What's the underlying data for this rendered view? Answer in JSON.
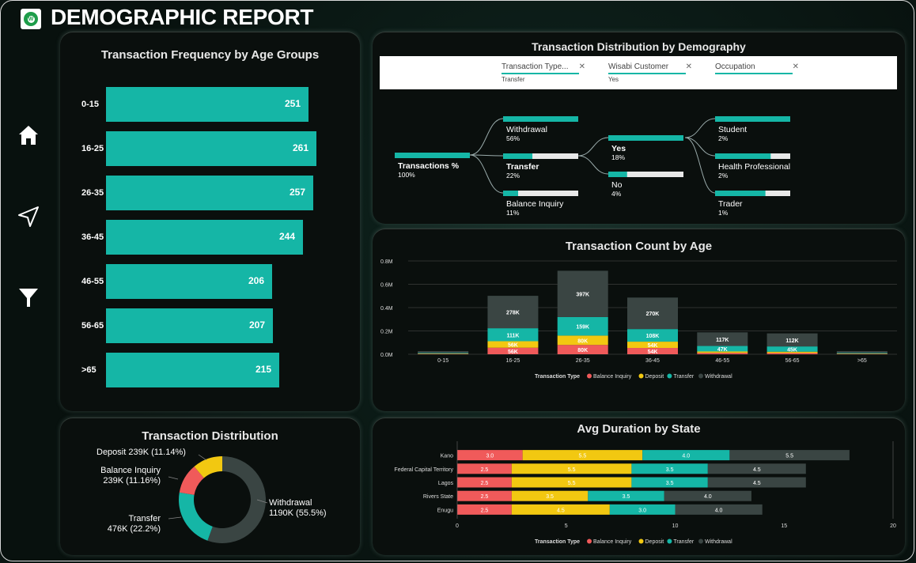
{
  "header": {
    "title": "DEMOGRAPHIC REPORT"
  },
  "colors": {
    "teal": "#15b6a6",
    "red": "#f05a5a",
    "yellow": "#f2c811",
    "gray": "#3a4543"
  },
  "age_card": {
    "title": "Transaction Frequency by Age Groups",
    "chart_data": {
      "type": "bar",
      "categories": [
        "0-15",
        "16-25",
        "26-35",
        "36-45",
        "46-55",
        "56-65",
        ">65"
      ],
      "values": [
        251,
        261,
        257,
        244,
        206,
        207,
        215
      ]
    }
  },
  "decomp": {
    "title": "Transaction Distribution by Demography",
    "filters": [
      {
        "name": "Transaction Type...",
        "value": "Transfer",
        "x": "✕"
      },
      {
        "name": "Wisabi Customer",
        "value": "Yes",
        "x": "✕"
      },
      {
        "name": "Occupation",
        "value": "",
        "x": "✕"
      }
    ],
    "root": {
      "label": "Transactions %",
      "pct": "100%",
      "fill": 1.0
    },
    "level1": [
      {
        "label": "Withdrawal",
        "pct": "56%",
        "fill": 1.0,
        "bold": false
      },
      {
        "label": "Transfer",
        "pct": "22%",
        "fill": 0.39,
        "bold": true
      },
      {
        "label": "Balance Inquiry",
        "pct": "11%",
        "fill": 0.2,
        "bold": false
      }
    ],
    "level2": [
      {
        "label": "Yes",
        "pct": "18%",
        "fill": 1.0,
        "bold": true
      },
      {
        "label": "No",
        "pct": "4%",
        "fill": 0.25,
        "bold": false
      }
    ],
    "level3": [
      {
        "label": "Student",
        "pct": "2%",
        "fill": 1.0
      },
      {
        "label": "Health Professional",
        "pct": "2%",
        "fill": 0.74
      },
      {
        "label": "Trader",
        "pct": "1%",
        "fill": 0.67
      }
    ]
  },
  "count_card": {
    "title": "Transaction Count by Age",
    "legend_title": "Transaction Type",
    "chart_data": {
      "type": "bar",
      "stacked": true,
      "categories": [
        "0-15",
        "16-25",
        "26-35",
        "36-45",
        "46-55",
        "56-65",
        ">65"
      ],
      "y_ticks": [
        "0.0M",
        "0.2M",
        "0.4M",
        "0.6M",
        "0.8M"
      ],
      "ylim": [
        0,
        800000
      ],
      "series": [
        {
          "name": "Balance Inquiry",
          "color": "#f05a5a",
          "values": [
            3000,
            56000,
            80000,
            54000,
            12000,
            11000,
            3000
          ],
          "labels": [
            "",
            "56K",
            "80K",
            "54K",
            "",
            "",
            ""
          ]
        },
        {
          "name": "Deposit",
          "color": "#f2c811",
          "values": [
            3000,
            56000,
            80000,
            54000,
            12000,
            11000,
            3000
          ],
          "labels": [
            "",
            "56K",
            "80K",
            "54K",
            "",
            "",
            ""
          ]
        },
        {
          "name": "Transfer",
          "color": "#15b6a6",
          "values": [
            6000,
            111000,
            159000,
            108000,
            47000,
            45000,
            6000
          ],
          "labels": [
            "",
            "111K",
            "159K",
            "108K",
            "47K",
            "45K",
            ""
          ]
        },
        {
          "name": "Withdrawal",
          "color": "#3a4543",
          "values": [
            15000,
            278000,
            397000,
            270000,
            117000,
            112000,
            15000
          ],
          "labels": [
            "",
            "278K",
            "397K",
            "270K",
            "117K",
            "112K",
            ""
          ]
        }
      ]
    }
  },
  "dist_card": {
    "title": "Transaction Distribution",
    "chart_data": {
      "type": "pie",
      "donut": true,
      "slices": [
        {
          "name": "Withdrawal",
          "value": 1190,
          "color": "#3a4543",
          "line1": "Withdrawal",
          "line2": "1190K (55.5%)"
        },
        {
          "name": "Transfer",
          "value": 476,
          "color": "#15b6a6",
          "line1": "Transfer",
          "line2": "476K (22.2%)"
        },
        {
          "name": "Balance Inquiry",
          "value": 239,
          "color": "#f05a5a",
          "line1": "Balance Inquiry",
          "line2": "239K (11.16%)"
        },
        {
          "name": "Deposit",
          "value": 239,
          "color": "#f2c811",
          "line1": "Deposit 239K (11.14%)",
          "line2": ""
        }
      ]
    }
  },
  "duration_card": {
    "title": "Avg Duration by State",
    "legend_title": "Transaction Type",
    "chart_data": {
      "type": "bar",
      "orientation": "horizontal",
      "stacked": true,
      "categories": [
        "Kano",
        "Federal Capital Territory",
        "Lagos",
        "Rivers State",
        "Enugu"
      ],
      "xlim": [
        0,
        20
      ],
      "x_ticks": [
        "0",
        "5",
        "10",
        "15",
        "20"
      ],
      "series": [
        {
          "name": "Balance Inquiry",
          "color": "#f05a5a",
          "values": [
            3.0,
            2.5,
            2.5,
            2.5,
            2.5
          ],
          "labels": [
            "3.0",
            "2.5",
            "2.5",
            "2.5",
            "2.5"
          ]
        },
        {
          "name": "Deposit",
          "color": "#f2c811",
          "values": [
            5.5,
            5.5,
            5.5,
            3.5,
            4.5
          ],
          "labels": [
            "5.5",
            "5.5",
            "5.5",
            "3.5",
            "4.5"
          ]
        },
        {
          "name": "Transfer",
          "color": "#15b6a6",
          "values": [
            4.0,
            3.5,
            3.5,
            3.5,
            3.0
          ],
          "labels": [
            "4.0",
            "3.5",
            "3.5",
            "3.5",
            "3.0"
          ]
        },
        {
          "name": "Withdrawal",
          "color": "#3a4543",
          "values": [
            5.5,
            4.5,
            4.5,
            4.0,
            4.0
          ],
          "labels": [
            "5.5",
            "4.5",
            "4.5",
            "4.0",
            "4.0"
          ]
        }
      ]
    }
  }
}
